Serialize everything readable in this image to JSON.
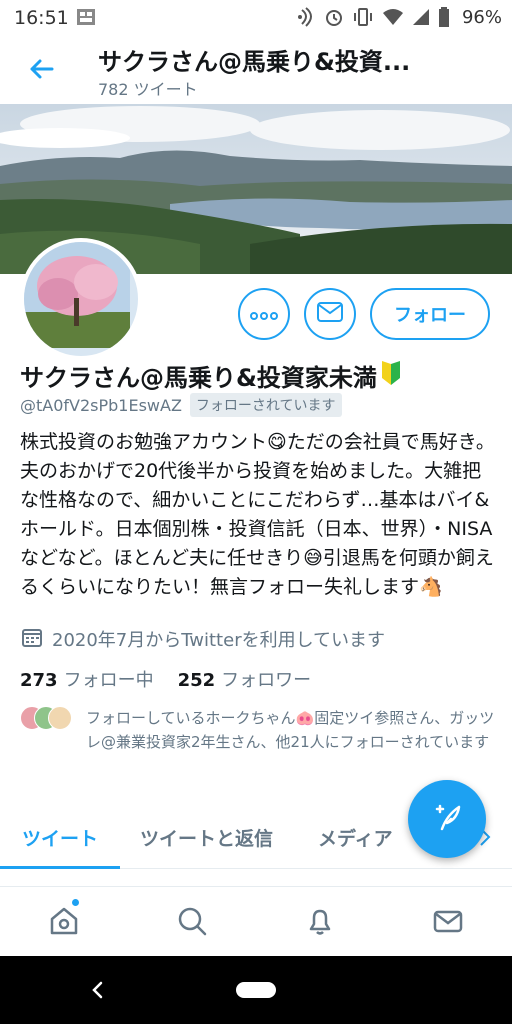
{
  "status_bar": {
    "time": "16:51",
    "battery": "96%",
    "icons": [
      "sim-card-icon",
      "nfc-icon",
      "alarm-icon",
      "vibrate-icon",
      "wifi-icon",
      "signal-icon",
      "battery-icon"
    ]
  },
  "header": {
    "title": "サクラさん@馬乗り&投資...",
    "tweet_count": "782 ツイート"
  },
  "profile": {
    "name": "サクラさん@馬乗り&投資家未満",
    "name_emoji": "beginner-mark-icon",
    "handle": "@tA0fV2sPb1EswAZ",
    "follows_you": "フォローされています",
    "bio": "株式投資のお勉強アカウント😋ただの会社員で馬好き。夫のおかげで20代後半から投資を始めました。大雑把な性格なので、細かいことにこだわらず…基本はバイ&ホールド。日本個別株・投資信託（日本、世界）・NISAなどなど。ほとんど夫に任せきり😅引退馬を何頭か飼えるくらいになりたい！無言フォロー失礼します🐴",
    "joined": "2020年7月からTwitterを利用しています",
    "following_count": "273",
    "following_label": "フォロー中",
    "followers_count": "252",
    "followers_label": "フォロワー",
    "followed_by": "フォローしているホークちゃん🐽固定ツイ参照さん、ガッツレ@兼業投資家2年生さん、他21人にフォローされています"
  },
  "actions": {
    "more_icon": "more-icon",
    "mail_icon": "mail-icon",
    "follow_label": "フォロー"
  },
  "tabs": [
    "ツイート",
    "ツイートと返信",
    "メディア"
  ],
  "active_tab": "ツイート",
  "bottom_nav": [
    "home-icon",
    "search-icon",
    "notifications-icon",
    "messages-icon"
  ],
  "colors": {
    "accent": "#1da1f2",
    "secondary_text": "#657786"
  }
}
